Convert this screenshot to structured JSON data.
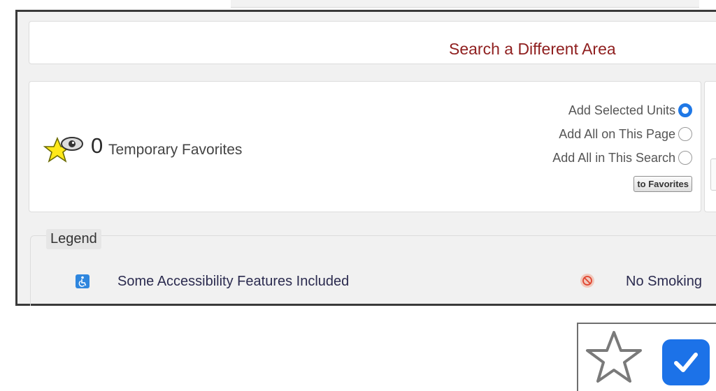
{
  "search": {
    "link_label": "Search a Different Area"
  },
  "favorites": {
    "count": "0",
    "label": "Temporary Favorites",
    "options": [
      {
        "label": "Add Selected Units",
        "selected": true
      },
      {
        "label": "Add All on This Page",
        "selected": false
      },
      {
        "label": "Add All in This Search",
        "selected": false
      }
    ],
    "button_label": "to Favorites"
  },
  "legend": {
    "title": "Legend",
    "items": [
      {
        "icon": "accessibility-icon",
        "label": "Some Accessibility Features Included"
      },
      {
        "icon": "no-smoking-icon",
        "label": "No Smoking"
      }
    ]
  },
  "icons": {
    "favorites": "star-eye-icon",
    "star_outline": "star-outline-icon",
    "checkbox": "checkbox-checked-icon"
  },
  "colors": {
    "link": "#8f1f1f",
    "accent": "#1f78e6",
    "legend_text": "#2b2b4f"
  }
}
